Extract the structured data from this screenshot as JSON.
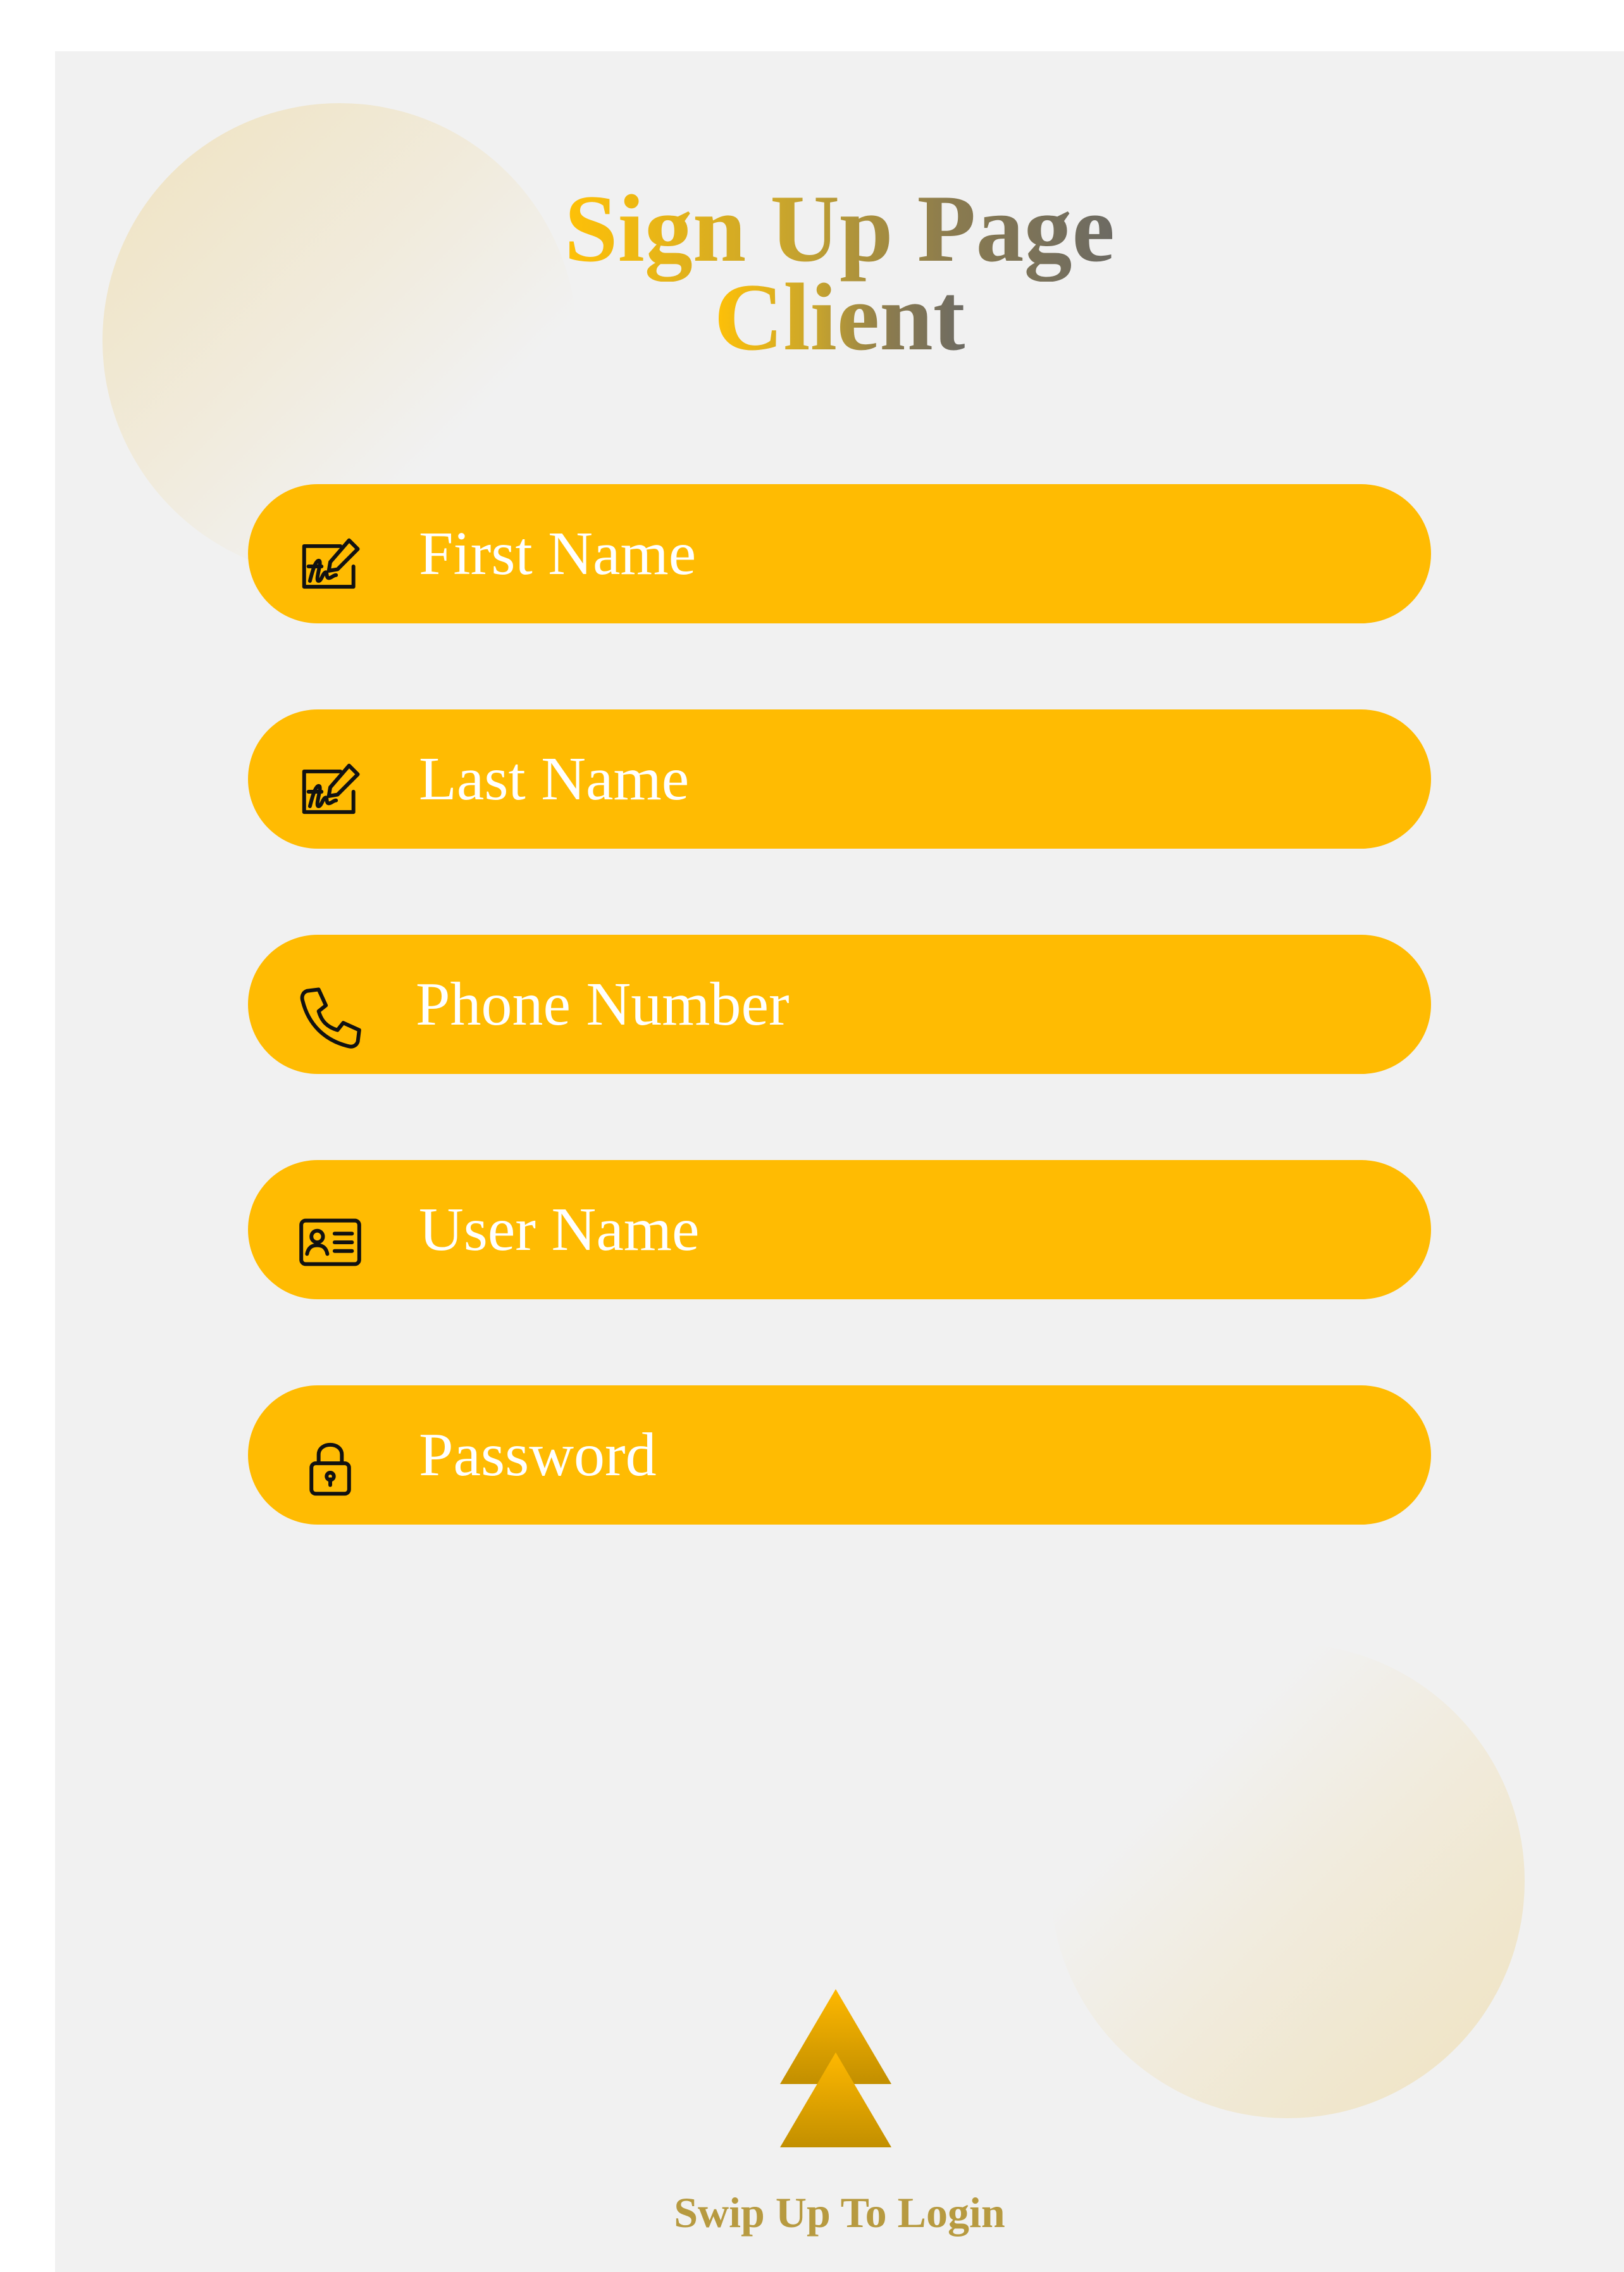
{
  "header": {
    "title_line1": "Sign Up Page",
    "title_line2": "Client"
  },
  "form": {
    "fields": [
      {
        "placeholder": "First Name",
        "icon": "signature-icon"
      },
      {
        "placeholder": "Last Name",
        "icon": "signature-icon"
      },
      {
        "placeholder": "Phone Number",
        "icon": "phone-icon"
      },
      {
        "placeholder": "User Name",
        "icon": "id-card-icon"
      },
      {
        "placeholder": "Password",
        "icon": "lock-icon"
      }
    ]
  },
  "footer": {
    "swipe_label": "Swip Up To Login",
    "icon": "double-arrow-up-icon"
  },
  "colors": {
    "field_background": "#ffbb02",
    "page_background": "#f1f1f1",
    "title_gradient_start": "#ffc107",
    "title_gradient_end": "#6c6a63",
    "swipe_label": "#b79a40",
    "field_text": "#ffffff"
  }
}
